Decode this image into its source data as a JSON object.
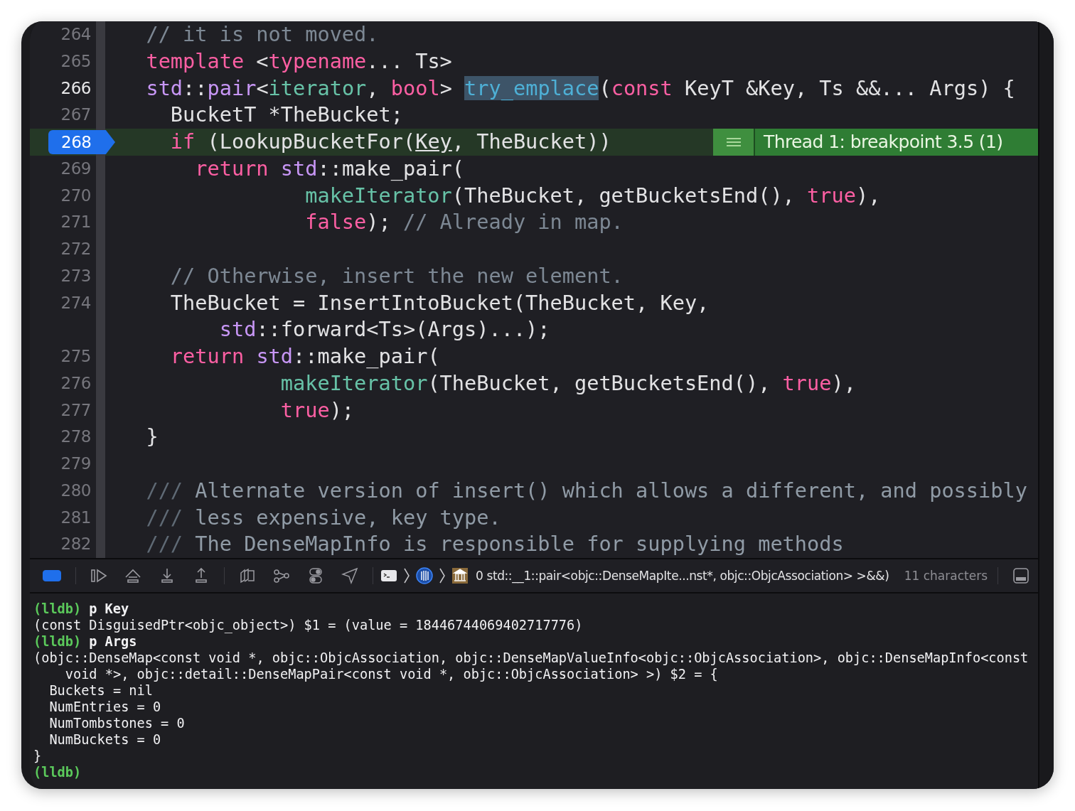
{
  "editor": {
    "rows": [
      {
        "number": "264",
        "current": false,
        "breakpoint": false,
        "tokens": [
          {
            "text": "  // it is not moved.",
            "kind": "comment"
          }
        ]
      },
      {
        "number": "265",
        "current": false,
        "breakpoint": false,
        "tokens": [
          {
            "text": "  template",
            "kind": "keyword"
          },
          {
            "text": " <",
            "kind": "plain"
          },
          {
            "text": "typename",
            "kind": "keyword"
          },
          {
            "text": "... Ts>",
            "kind": "plain"
          }
        ]
      },
      {
        "number": "266",
        "current": true,
        "breakpoint": false,
        "tokens": [
          {
            "text": "  std",
            "kind": "type"
          },
          {
            "text": "::",
            "kind": "plain"
          },
          {
            "text": "pair",
            "kind": "type"
          },
          {
            "text": "<",
            "kind": "plain"
          },
          {
            "text": "iterator",
            "kind": "project"
          },
          {
            "text": ", ",
            "kind": "plain"
          },
          {
            "text": "bool",
            "kind": "keyword"
          },
          {
            "text": "> ",
            "kind": "plain"
          },
          {
            "text": "try_emplace",
            "kind": "selected"
          },
          {
            "text": "(",
            "kind": "plain"
          },
          {
            "text": "const",
            "kind": "keyword"
          },
          {
            "text": " KeyT &Key, Ts &&... Args) {",
            "kind": "plain"
          }
        ]
      },
      {
        "number": "267",
        "current": false,
        "breakpoint": false,
        "tokens": [
          {
            "text": "    BucketT *TheBucket;",
            "kind": "plain"
          }
        ]
      },
      {
        "number": "268",
        "current": false,
        "breakpoint": true,
        "tokens": [
          {
            "text": "    if",
            "kind": "keyword"
          },
          {
            "text": " (LookupBucketFor(",
            "kind": "plain"
          },
          {
            "text": "Key",
            "kind": "underlined"
          },
          {
            "text": ", TheBucket))",
            "kind": "plain"
          }
        ],
        "annotation": "Thread 1: breakpoint 3.5 (1)"
      },
      {
        "number": "269",
        "current": false,
        "breakpoint": false,
        "tokens": [
          {
            "text": "      return ",
            "kind": "keyword"
          },
          {
            "text": "std",
            "kind": "type"
          },
          {
            "text": "::make_pair(",
            "kind": "plain"
          }
        ]
      },
      {
        "number": "270",
        "current": false,
        "breakpoint": false,
        "tokens": [
          {
            "text": "               makeIterator",
            "kind": "project"
          },
          {
            "text": "(TheBucket, getBucketsEnd(), ",
            "kind": "plain"
          },
          {
            "text": "true",
            "kind": "keyword"
          },
          {
            "text": "),",
            "kind": "plain"
          }
        ]
      },
      {
        "number": "271",
        "current": false,
        "breakpoint": false,
        "tokens": [
          {
            "text": "               false",
            "kind": "keyword"
          },
          {
            "text": "); ",
            "kind": "plain"
          },
          {
            "text": "// Already in map.",
            "kind": "comment"
          }
        ]
      },
      {
        "number": "272",
        "current": false,
        "breakpoint": false,
        "tokens": []
      },
      {
        "number": "273",
        "current": false,
        "breakpoint": false,
        "tokens": [
          {
            "text": "    // Otherwise, insert the new element.",
            "kind": "comment"
          }
        ]
      },
      {
        "number": "274",
        "current": false,
        "breakpoint": false,
        "tokens": [
          {
            "text": "    TheBucket = InsertIntoBucket(TheBucket, Key,",
            "kind": "plain"
          }
        ]
      },
      {
        "tokens": [
          {
            "text": "        std",
            "kind": "type"
          },
          {
            "text": "::forward<Ts>(Args)...);",
            "kind": "plain"
          }
        ]
      },
      {
        "number": "275",
        "current": false,
        "breakpoint": false,
        "tokens": [
          {
            "text": "    return ",
            "kind": "keyword"
          },
          {
            "text": "std",
            "kind": "type"
          },
          {
            "text": "::make_pair(",
            "kind": "plain"
          }
        ]
      },
      {
        "number": "276",
        "current": false,
        "breakpoint": false,
        "tokens": [
          {
            "text": "             makeIterator",
            "kind": "project"
          },
          {
            "text": "(TheBucket, getBucketsEnd(), ",
            "kind": "plain"
          },
          {
            "text": "true",
            "kind": "keyword"
          },
          {
            "text": "),",
            "kind": "plain"
          }
        ]
      },
      {
        "number": "277",
        "current": false,
        "breakpoint": false,
        "tokens": [
          {
            "text": "             true",
            "kind": "keyword"
          },
          {
            "text": ");",
            "kind": "plain"
          }
        ]
      },
      {
        "number": "278",
        "current": false,
        "breakpoint": false,
        "tokens": [
          {
            "text": "  }",
            "kind": "plain"
          }
        ]
      },
      {
        "number": "279",
        "current": false,
        "breakpoint": false,
        "tokens": []
      },
      {
        "number": "280",
        "current": false,
        "breakpoint": false,
        "tokens": [
          {
            "text": "  ///",
            "kind": "doc-marker"
          },
          {
            "text": " Alternate version of insert() which allows a different, and possibly",
            "kind": "doc"
          }
        ]
      },
      {
        "number": "281",
        "current": false,
        "breakpoint": false,
        "tokens": [
          {
            "text": "  ///",
            "kind": "doc-marker"
          },
          {
            "text": " less expensive, key type.",
            "kind": "doc"
          }
        ]
      },
      {
        "number": "282",
        "current": false,
        "breakpoint": false,
        "tokens": [
          {
            "text": "  ///",
            "kind": "doc-marker"
          },
          {
            "text": " The DenseMapInfo is responsible for supplying methods",
            "kind": "doc"
          }
        ]
      }
    ]
  },
  "debug_bar": {
    "breakpoints_active": true,
    "frame": "0 std::__1::pair<objc::DenseMapIte...nst*, objc::ObjcAssociation> >&&)",
    "selection_info": "11 characters"
  },
  "console": {
    "lines": [
      {
        "kind": "prompt",
        "prompt": "(lldb)",
        "command": "p Key"
      },
      {
        "kind": "output",
        "text": "(const DisguisedPtr<objc_object>) $1 = (value = 18446744069402717776)"
      },
      {
        "kind": "prompt",
        "prompt": "(lldb)",
        "command": "p Args"
      },
      {
        "kind": "output",
        "text": "(objc::DenseMap<const void *, objc::ObjcAssociation, objc::DenseMapValueInfo<objc::ObjcAssociation>, objc::DenseMapInfo<const"
      },
      {
        "kind": "output",
        "text": "    void *>, objc::detail::DenseMapPair<const void *, objc::ObjcAssociation> >) $2 = {"
      },
      {
        "kind": "output",
        "text": "  Buckets = nil"
      },
      {
        "kind": "output",
        "text": "  NumEntries = 0"
      },
      {
        "kind": "output",
        "text": "  NumTombstones = 0"
      },
      {
        "kind": "output",
        "text": "  NumBuckets = 0"
      },
      {
        "kind": "output",
        "text": "}"
      },
      {
        "kind": "prompt",
        "prompt": "(lldb)"
      }
    ]
  }
}
